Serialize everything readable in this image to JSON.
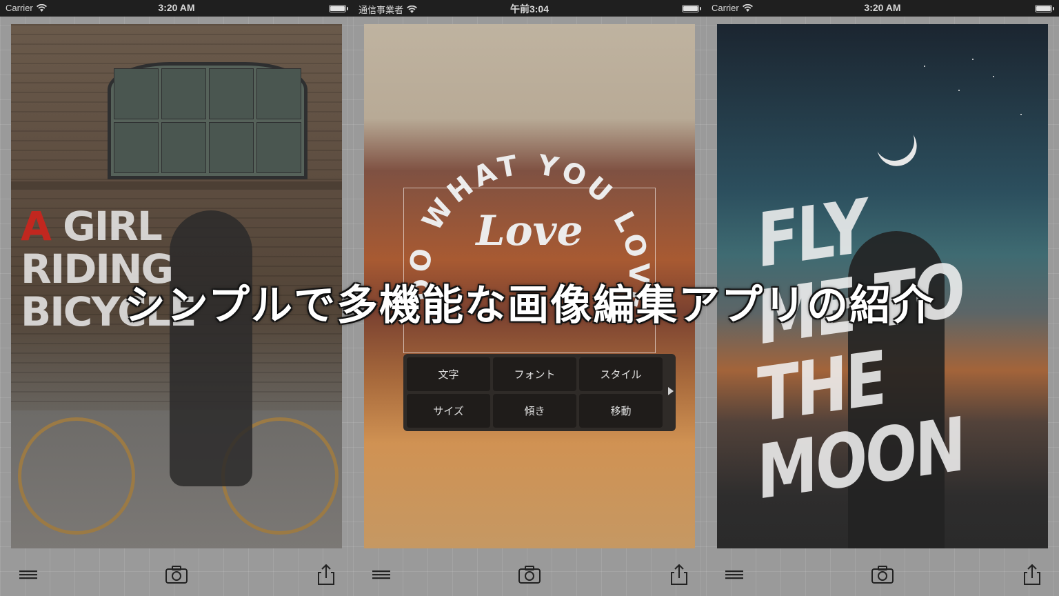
{
  "caption": "シンプルで多機能な画像編集アプリの紹介",
  "screens": [
    {
      "status": {
        "carrier": "Carrier",
        "time": "3:20 AM"
      },
      "overlay_text": {
        "first_letter": "A",
        "line1_rest": " GIRL",
        "line2": "RIDING",
        "line3": "BICYCLE"
      },
      "accent_color": "#c2271f"
    },
    {
      "status": {
        "carrier": "通信事業者",
        "time": "午前3:04"
      },
      "arc_text": "DO WHAT YOU LOVE LOVE WHAT YOU DO",
      "center_text": "Love",
      "panel": {
        "buttons": [
          "文字",
          "フォント",
          "スタイル",
          "サイズ",
          "傾き",
          "移動"
        ]
      }
    },
    {
      "status": {
        "carrier": "Carrier",
        "time": "3:20 AM"
      },
      "overlay_text": {
        "line1": "FLY ME TO",
        "line2": "THE MOON"
      }
    }
  ],
  "toolbar": {
    "icons": [
      "menu-icon",
      "camera-icon",
      "share-icon"
    ]
  }
}
